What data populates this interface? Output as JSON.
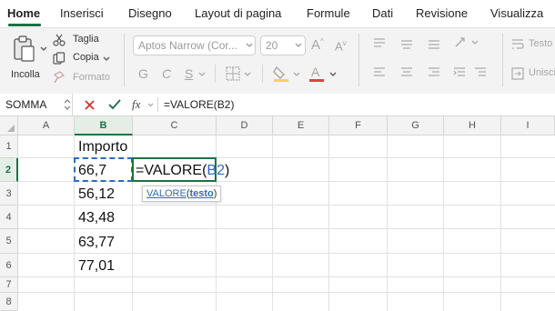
{
  "tabs": [
    "Home",
    "Inserisci",
    "Disegno",
    "Layout di pagina",
    "Formule",
    "Dati",
    "Revisione",
    "Visualizza"
  ],
  "ribbon": {
    "paste_label": "Incolla",
    "cut_label": "Taglia",
    "copy_label": "Copia",
    "format_label": "Formato",
    "font_name": "Aptos Narrow (Cor...",
    "font_size": "20",
    "bold": "G",
    "italic": "C",
    "underline": "S",
    "wrap_label": "Testo",
    "merge_label": "Unisci"
  },
  "formula_bar": {
    "name_box": "SOMMA",
    "fx": "fx",
    "formula": "=VALORE(B2)"
  },
  "columns": [
    "A",
    "B",
    "C",
    "D",
    "E",
    "F",
    "G",
    "H",
    "I"
  ],
  "rows": [
    "1",
    "2",
    "3",
    "4",
    "5",
    "6",
    "7",
    "8"
  ],
  "cells": {
    "b1": "Importo",
    "b2": "66,7",
    "b3": "56,12",
    "b4": "43,48",
    "b5": "63,77",
    "b6": "77,01",
    "c2_prefix": "=VALORE(",
    "c2_ref": "B2",
    "c2_suffix": ")"
  },
  "tooltip": {
    "func": "VALORE",
    "open": "(",
    "arg": "testo",
    "close": ")"
  },
  "colors": {
    "accent": "#1e7145",
    "reference_blue": "#2f6bbf"
  }
}
